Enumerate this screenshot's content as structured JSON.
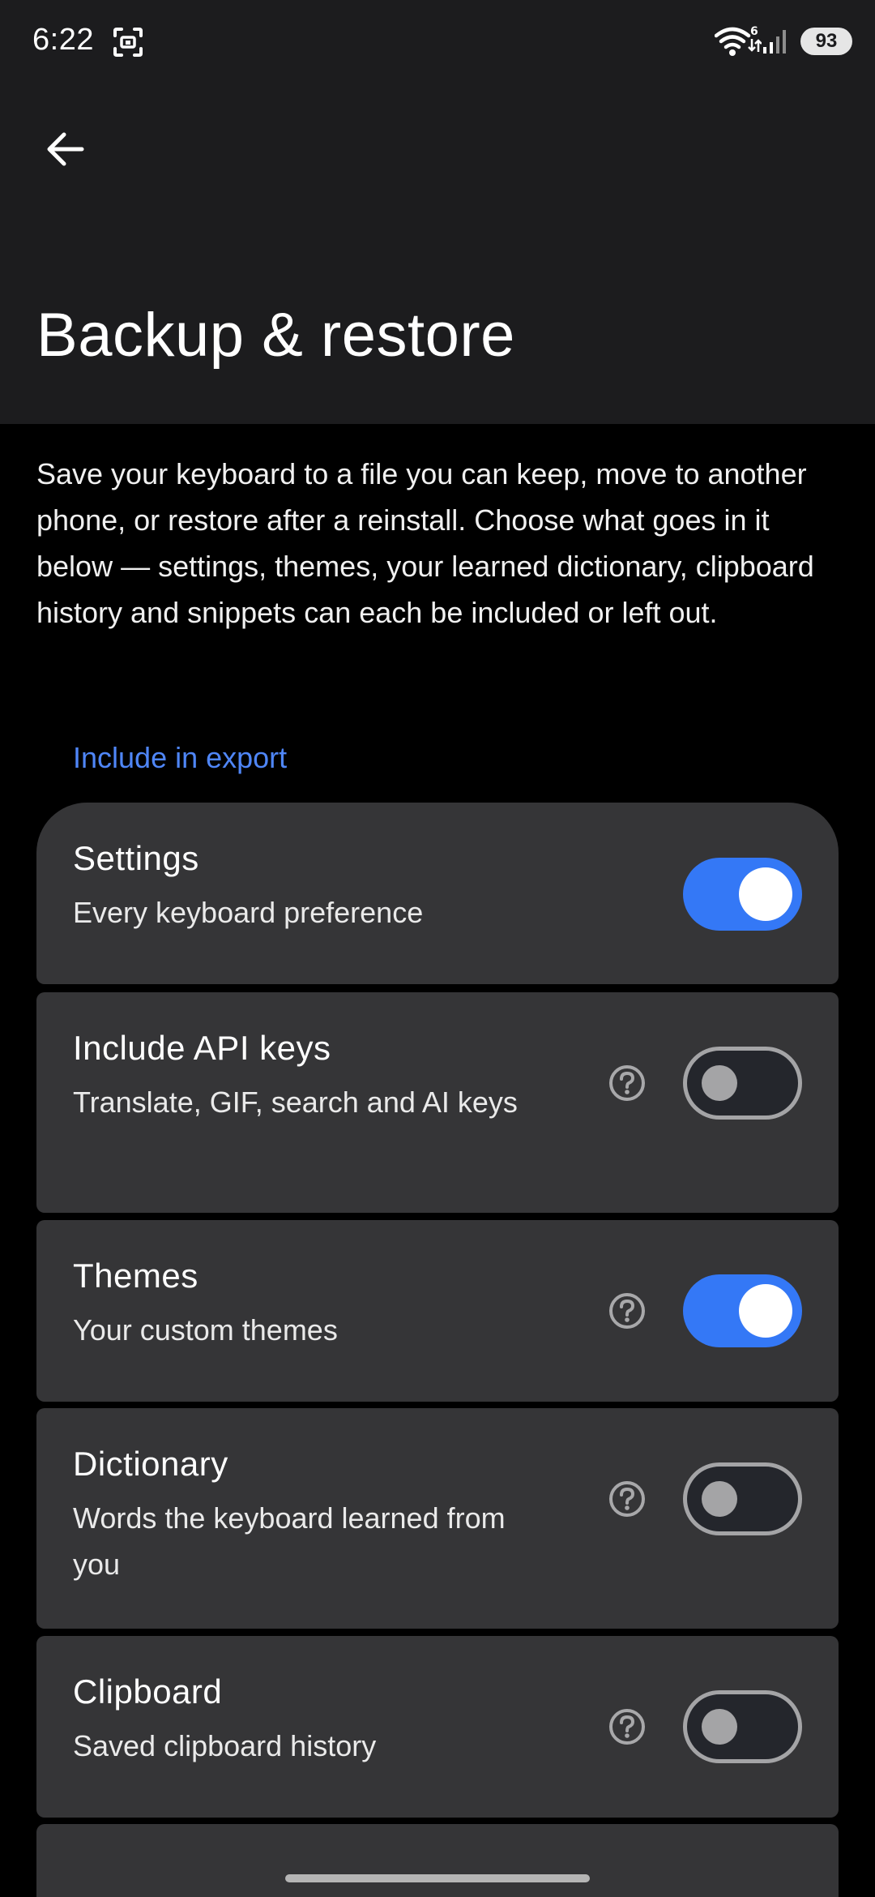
{
  "status_bar": {
    "time": "6:22",
    "battery": "93",
    "icons": [
      "screenshot-icon",
      "wifi-icon",
      "signal-icon"
    ]
  },
  "header": {
    "title": "Backup & restore",
    "back_icon": "arrow-back-icon"
  },
  "description": "Save your keyboard to a file you can keep, move to another phone, or restore after a reinstall. Choose what goes in it below — settings, themes, your learned dictionary, clipboard history and snippets can each be included or left out.",
  "section": {
    "title": "Include in export"
  },
  "items": [
    {
      "title": "Settings",
      "subtitle": "Every keyboard preference",
      "enabled": true,
      "has_help": false
    },
    {
      "title": "Include API keys",
      "subtitle": "Translate, GIF, search and AI keys",
      "enabled": false,
      "has_help": true
    },
    {
      "title": "Themes",
      "subtitle": "Your custom themes",
      "enabled": true,
      "has_help": true
    },
    {
      "title": "Dictionary",
      "subtitle": "Words the keyboard learned from you",
      "enabled": false,
      "has_help": true
    },
    {
      "title": "Clipboard",
      "subtitle": "Saved clipboard history",
      "enabled": false,
      "has_help": true
    }
  ],
  "colors": {
    "accent": "#4f86f7",
    "toggle_on": "#3478f6",
    "card": "#353537",
    "appbar": "#1c1c1e",
    "background": "#000000"
  }
}
